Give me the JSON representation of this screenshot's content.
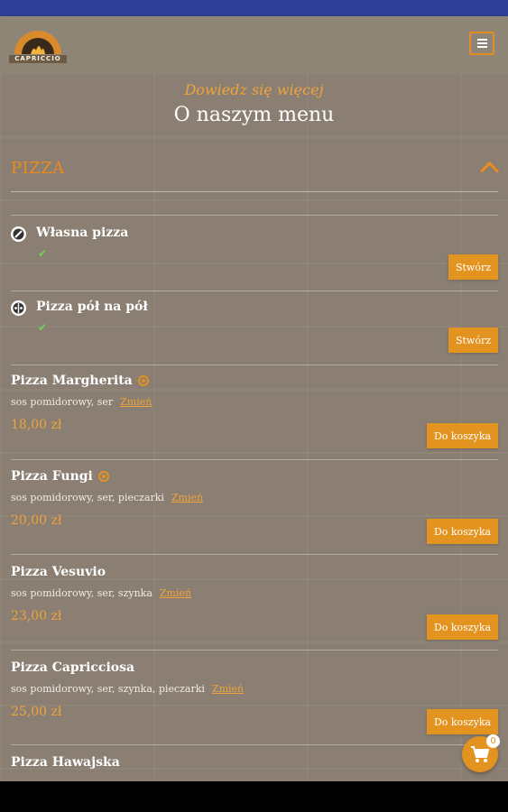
{
  "header": {
    "logo_text": "CAPRICCIO",
    "menu_icon": "hamburger-icon"
  },
  "section": {
    "kicker": "Dowiedz się więcej",
    "title": "O naszym menu"
  },
  "category": {
    "name": "PIZZA",
    "toggle_icon": "chevron-up-icon"
  },
  "special_items": [
    {
      "title": "Własna pizza",
      "icon": "custom-pizza-icon",
      "button": "Stwórz"
    },
    {
      "title": "Pizza pół na pół",
      "icon": "half-half-icon",
      "button": "Stwórz"
    }
  ],
  "items": [
    {
      "title": "Pizza Margherita",
      "vegetarian": true,
      "desc": "sos pomidorowy, ser",
      "change": "Zmień",
      "price": "18,00 zł",
      "button": "Do koszyka"
    },
    {
      "title": "Pizza Fungi",
      "vegetarian": true,
      "desc": "sos pomidorowy, ser, pieczarki",
      "change": "Zmień",
      "price": "20,00 zł",
      "button": "Do koszyka"
    },
    {
      "title": "Pizza Vesuvio",
      "vegetarian": false,
      "desc": "sos pomidorowy, ser, szynka",
      "change": "Zmień",
      "price": "23,00 zł",
      "button": "Do koszyka"
    },
    {
      "title": "Pizza Capricciosa",
      "vegetarian": false,
      "desc": "sos pomidorowy, ser, szynka, pieczarki",
      "change": "Zmień",
      "price": "25,00 zł",
      "button": "Do koszyka"
    },
    {
      "title": "Pizza Hawajska"
    }
  ],
  "cart": {
    "count": "0",
    "icon": "cart-icon"
  },
  "colors": {
    "accent": "#e3931f",
    "background": "#8a7f72",
    "statusbar": "#2f3f98"
  }
}
